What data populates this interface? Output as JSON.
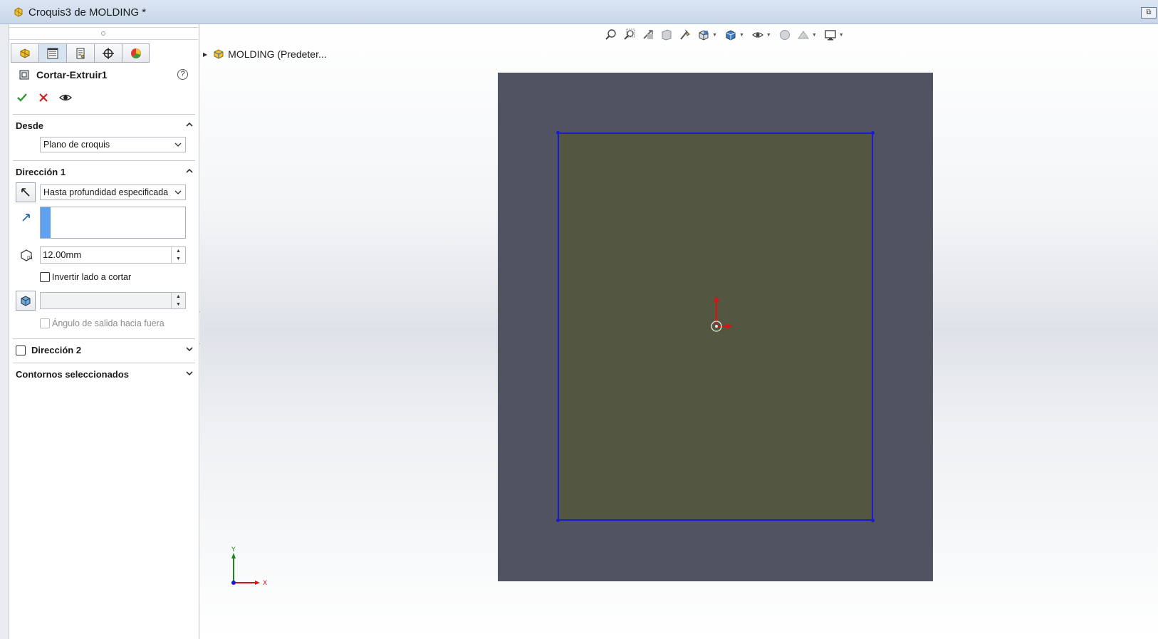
{
  "window": {
    "title": "Croquis3 de MOLDING *"
  },
  "panel": {
    "tabs": [
      "feature-manager",
      "property-manager",
      "configuration-manager",
      "dimxpert-manager",
      "display-manager"
    ],
    "feature_title": "Cortar-Extruir1",
    "help": "?",
    "sections": {
      "desde": {
        "label": "Desde",
        "value": "Plano de croquis"
      },
      "direccion1": {
        "label": "Dirección 1",
        "end_condition": "Hasta profundidad especificada",
        "depth": "12.00mm",
        "flip_side_label": "Invertir lado a cortar",
        "draft_angle": "",
        "draft_outward_label": "Ángulo de salida hacia fuera"
      },
      "direccion2": {
        "label": "Dirección 2"
      },
      "contornos": {
        "label": "Contornos seleccionados"
      }
    }
  },
  "viewport": {
    "tree_root": "MOLDING  (Predeter...",
    "triad": {
      "y": "Y",
      "x": "X"
    }
  },
  "colors": {
    "accent_blue": "#1a1ad6",
    "face_fill": "#535640",
    "body_fill": "#505461",
    "selection_bar": "#5fa1f0"
  }
}
